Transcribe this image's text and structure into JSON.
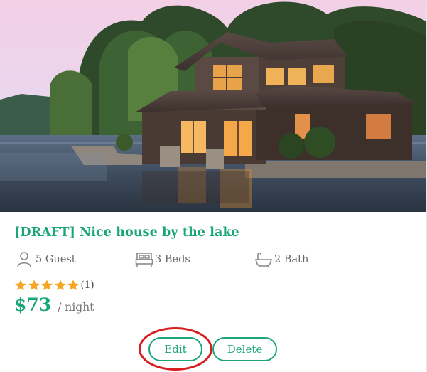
{
  "listing": {
    "title": "[DRAFT] Nice house by the lake",
    "image_alt": "Lake house at dusk",
    "features": {
      "guests": "5 Guest",
      "beds": "3 Beds",
      "baths": "2 Bath"
    },
    "rating": {
      "stars": 5,
      "count": "(1)"
    },
    "price": {
      "amount": "$73",
      "unit": "/ night"
    },
    "actions": {
      "edit_label": "Edit",
      "delete_label": "Delete"
    }
  },
  "colors": {
    "accent": "#1aa67a",
    "star": "#f5a623",
    "highlight": "#d81e1e"
  }
}
